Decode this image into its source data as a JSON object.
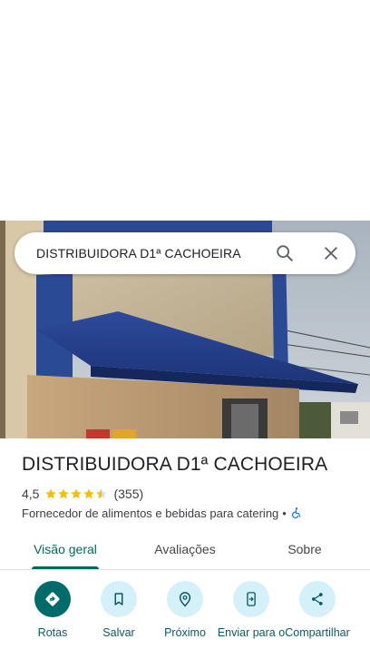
{
  "search": {
    "query": "DISTRIBUIDORA D1ª CACHOEIRA",
    "search_icon": "search-icon",
    "close_icon": "close-icon"
  },
  "place": {
    "name": "DISTRIBUIDORA D1ª CACHOEIRA",
    "rating": "4,5",
    "stars_filled": 4.5,
    "reviews": "(355)",
    "category": "Fornecedor de alimentos e bebidas para catering",
    "separator": "•",
    "accessibility_icon": "wheelchair-icon"
  },
  "tabs": [
    {
      "label": "Visão geral",
      "active": true
    },
    {
      "label": "Avaliações",
      "active": false
    },
    {
      "label": "Sobre",
      "active": false
    }
  ],
  "actions": [
    {
      "label": "Rotas",
      "icon": "directions-icon"
    },
    {
      "label": "Salvar",
      "icon": "bookmark-icon"
    },
    {
      "label": "Próximo",
      "icon": "nearby-icon"
    },
    {
      "label": "Enviar para o",
      "icon": "send-to-phone-icon"
    },
    {
      "label": "Compartilhar",
      "icon": "share-icon"
    }
  ],
  "colors": {
    "accent": "#00695c",
    "action_bg": "#d4f1f9",
    "primary_action": "#006b6b",
    "star": "#fbbc04",
    "accessibility": "#1a73e8"
  }
}
